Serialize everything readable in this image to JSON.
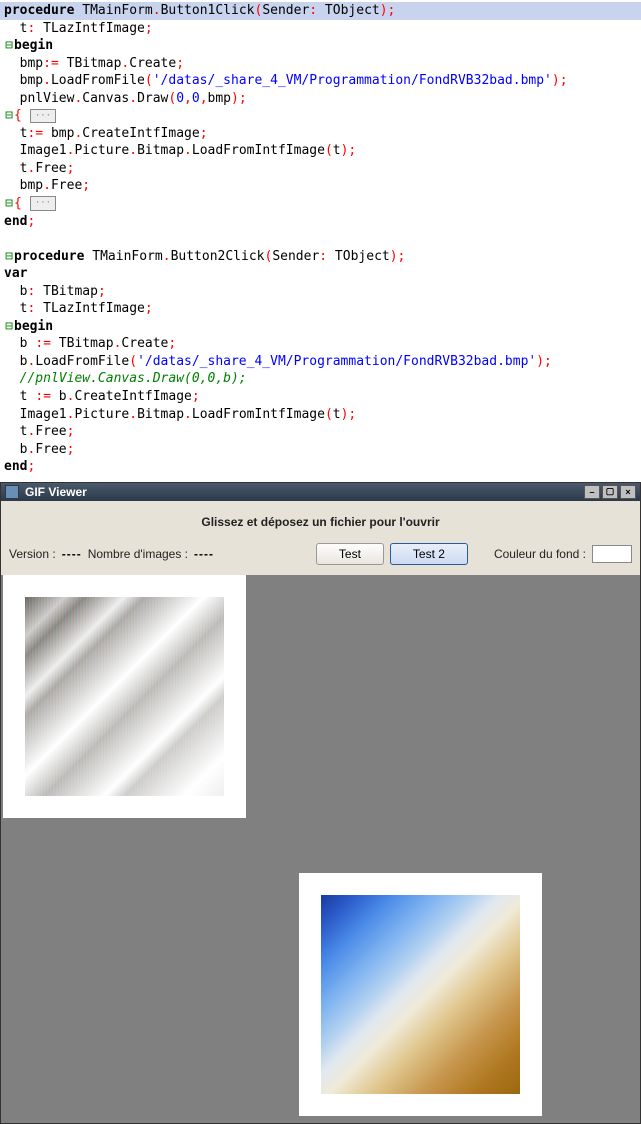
{
  "code": {
    "lines": [
      {
        "cls": "hl-line",
        "html": "<span class='kw'>procedure</span> TMainForm<span class='sym'>.</span>Button1Click<span class='sym'>(</span>Sender<span class='sym'>:</span> TObject<span class='sym'>);</span>"
      },
      {
        "html": "  t<span class='sym'>:</span> TLazIntfImage<span class='sym'>;</span>"
      },
      {
        "html": "<span class='fold-marker'>⊟</span><span class='kw'>begin</span>"
      },
      {
        "html": "  bmp<span class='sym'>:=</span> TBitmap<span class='sym'>.</span>Create<span class='sym'>;</span>"
      },
      {
        "html": "  bmp<span class='sym'>.</span>LoadFromFile<span class='sym'>(</span><span class='str'>'/datas/_share_4_VM/Programmation/FondRVB32bad.bmp'</span><span class='sym'>);</span>"
      },
      {
        "html": "  pnlView<span class='sym'>.</span>Canvas<span class='sym'>.</span>Draw<span class='sym'>(</span><span class='num'>0</span><span class='sym'>,</span><span class='num'>0</span><span class='sym'>,</span>bmp<span class='sym'>);</span>"
      },
      {
        "html": "<span class='fold-marker'>⊟</span><span class='sym'>{</span><span class='fold'>···</span>"
      },
      {
        "html": "  t<span class='sym'>:=</span> bmp<span class='sym'>.</span>CreateIntfImage<span class='sym'>;</span>"
      },
      {
        "html": "  Image1<span class='sym'>.</span>Picture<span class='sym'>.</span>Bitmap<span class='sym'>.</span>LoadFromIntfImage<span class='sym'>(</span>t<span class='sym'>);</span>"
      },
      {
        "html": "  t<span class='sym'>.</span>Free<span class='sym'>;</span>"
      },
      {
        "html": "  bmp<span class='sym'>.</span>Free<span class='sym'>;</span>"
      },
      {
        "html": "<span class='fold-marker'>⊟</span><span class='sym'>{</span><span class='fold'>···</span>"
      },
      {
        "html": "<span class='kw'>end</span><span class='sym'>;</span>"
      },
      {
        "html": " "
      },
      {
        "html": "<span class='fold-marker'>⊟</span><span class='kw'>procedure</span> TMainForm<span class='sym'>.</span>Button2Click<span class='sym'>(</span>Sender<span class='sym'>:</span> TObject<span class='sym'>);</span>"
      },
      {
        "html": "<span class='kw'>var</span>"
      },
      {
        "html": "  b<span class='sym'>:</span> TBitmap<span class='sym'>;</span>"
      },
      {
        "html": "  t<span class='sym'>:</span> TLazIntfImage<span class='sym'>;</span>"
      },
      {
        "html": "<span class='fold-marker'>⊟</span><span class='kw'>begin</span>"
      },
      {
        "html": "  b <span class='sym'>:=</span> TBitmap<span class='sym'>.</span>Create<span class='sym'>;</span>"
      },
      {
        "html": "  b<span class='sym'>.</span>LoadFromFile<span class='sym'>(</span><span class='str'>'/datas/_share_4_VM/Programmation/FondRVB32bad.bmp'</span><span class='sym'>);</span>"
      },
      {
        "html": "  <span class='cmt'>//pnlView.Canvas.Draw(0,0,b);</span>"
      },
      {
        "html": "  t <span class='sym'>:=</span> b<span class='sym'>.</span>CreateIntfImage<span class='sym'>;</span>"
      },
      {
        "html": "  Image1<span class='sym'>.</span>Picture<span class='sym'>.</span>Bitmap<span class='sym'>.</span>LoadFromIntfImage<span class='sym'>(</span>t<span class='sym'>);</span>"
      },
      {
        "html": "  t<span class='sym'>.</span>Free<span class='sym'>;</span>"
      },
      {
        "html": "  b<span class='sym'>.</span>Free<span class='sym'>;</span>"
      },
      {
        "html": "<span class='kw'>end</span><span class='sym'>;</span>"
      }
    ]
  },
  "window": {
    "title": "GIF Viewer",
    "instruction": "Glissez et déposez un fichier pour l'ouvrir",
    "version_label": "Version :",
    "version_value": "----",
    "images_label": "Nombre d'images :",
    "images_value": "----",
    "test_btn": "Test",
    "test2_btn": "Test 2",
    "bgcolor_label": "Couleur du fond :"
  }
}
